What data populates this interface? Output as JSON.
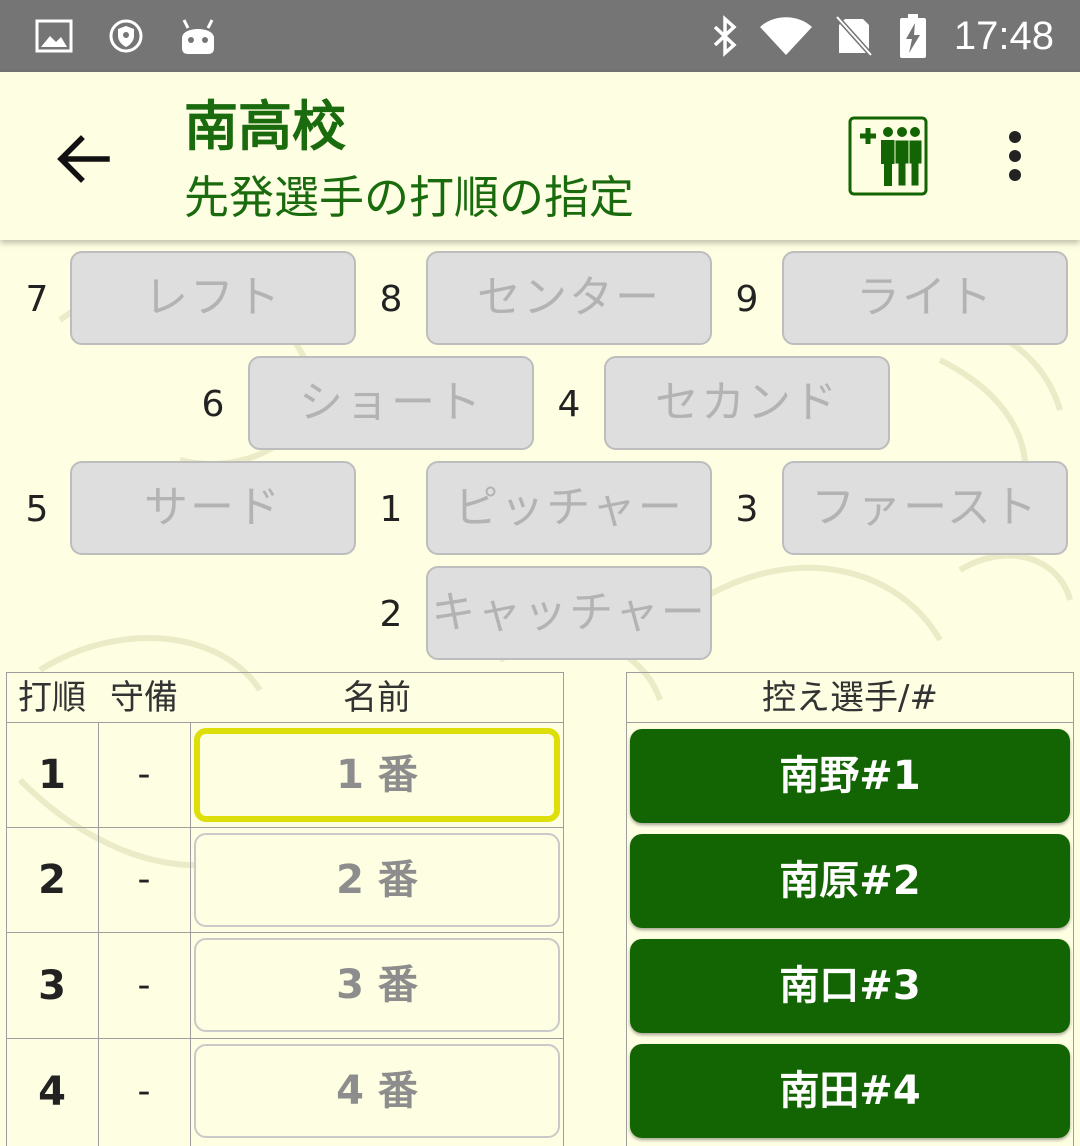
{
  "status_bar": {
    "time": "17:48",
    "icons": [
      "image-icon",
      "vpn-shield-icon",
      "android-icon",
      "bluetooth-icon",
      "wifi-icon",
      "no-sim-icon",
      "battery-charging-icon"
    ]
  },
  "app_bar": {
    "title": "南高校",
    "subtitle": "先発選手の打順の指定"
  },
  "positions": [
    {
      "num": "7",
      "label": "レフト"
    },
    {
      "num": "8",
      "label": "センター"
    },
    {
      "num": "9",
      "label": "ライト"
    },
    {
      "num": "6",
      "label": "ショート"
    },
    {
      "num": "4",
      "label": "セカンド"
    },
    {
      "num": "5",
      "label": "サード"
    },
    {
      "num": "1",
      "label": "ピッチャー"
    },
    {
      "num": "3",
      "label": "ファースト"
    },
    {
      "num": "2",
      "label": "キャッチャー"
    }
  ],
  "lineup": {
    "headers": {
      "order": "打順",
      "position": "守備",
      "name": "名前"
    },
    "rows": [
      {
        "order": "1",
        "position": "-",
        "name": "1 番",
        "selected": true
      },
      {
        "order": "2",
        "position": "-",
        "name": "2 番"
      },
      {
        "order": "3",
        "position": "-",
        "name": "3 番"
      },
      {
        "order": "4",
        "position": "-",
        "name": "4 番"
      }
    ]
  },
  "bench": {
    "header": "控え選手/#",
    "players": [
      "南野#1",
      "南原#2",
      "南口#3",
      "南田#4"
    ]
  },
  "colors": {
    "accent_green": "#136503",
    "title_green": "#1a6b0e",
    "background": "#fefee2",
    "selected_border": "#dede0a",
    "status_bar": "#757575"
  }
}
